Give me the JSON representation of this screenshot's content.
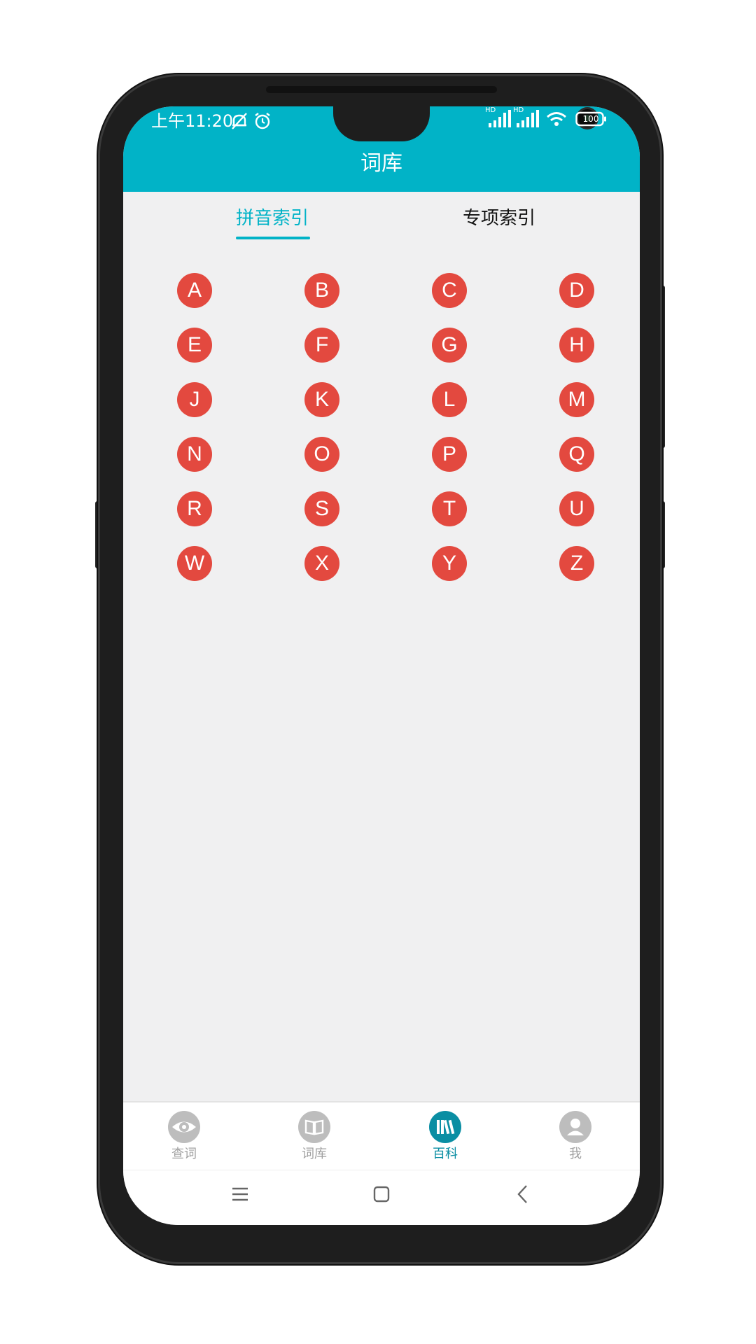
{
  "status_bar": {
    "time": "上午11:20",
    "signal_label_1": "HD",
    "signal_label_2": "HD",
    "battery": "100",
    "icons": [
      "mute-icon",
      "alarm-icon",
      "signal-icon",
      "signal-icon",
      "wifi-icon",
      "battery-icon"
    ]
  },
  "app_bar": {
    "title": "词库"
  },
  "tabs": [
    {
      "label": "拼音索引",
      "active": true
    },
    {
      "label": "专项索引",
      "active": false
    }
  ],
  "letters": [
    "A",
    "B",
    "C",
    "D",
    "E",
    "F",
    "G",
    "H",
    "J",
    "K",
    "L",
    "M",
    "N",
    "O",
    "P",
    "Q",
    "R",
    "S",
    "T",
    "U",
    "W",
    "X",
    "Y",
    "Z"
  ],
  "bottom_nav": [
    {
      "label": "查词",
      "icon": "eye-icon",
      "active": false
    },
    {
      "label": "词库",
      "icon": "book-icon",
      "active": false
    },
    {
      "label": "百科",
      "icon": "library-icon",
      "active": true
    },
    {
      "label": "我",
      "icon": "user-icon",
      "active": false
    }
  ],
  "system_nav": {
    "icons": [
      "menu-icon",
      "home-icon",
      "back-icon"
    ]
  },
  "colors": {
    "primary": "#01b3c7",
    "letter_bg": "#e3493f",
    "nav_active": "#0a8ea3",
    "nav_inactive": "#bdbdbd",
    "background": "#f0f0f1"
  }
}
